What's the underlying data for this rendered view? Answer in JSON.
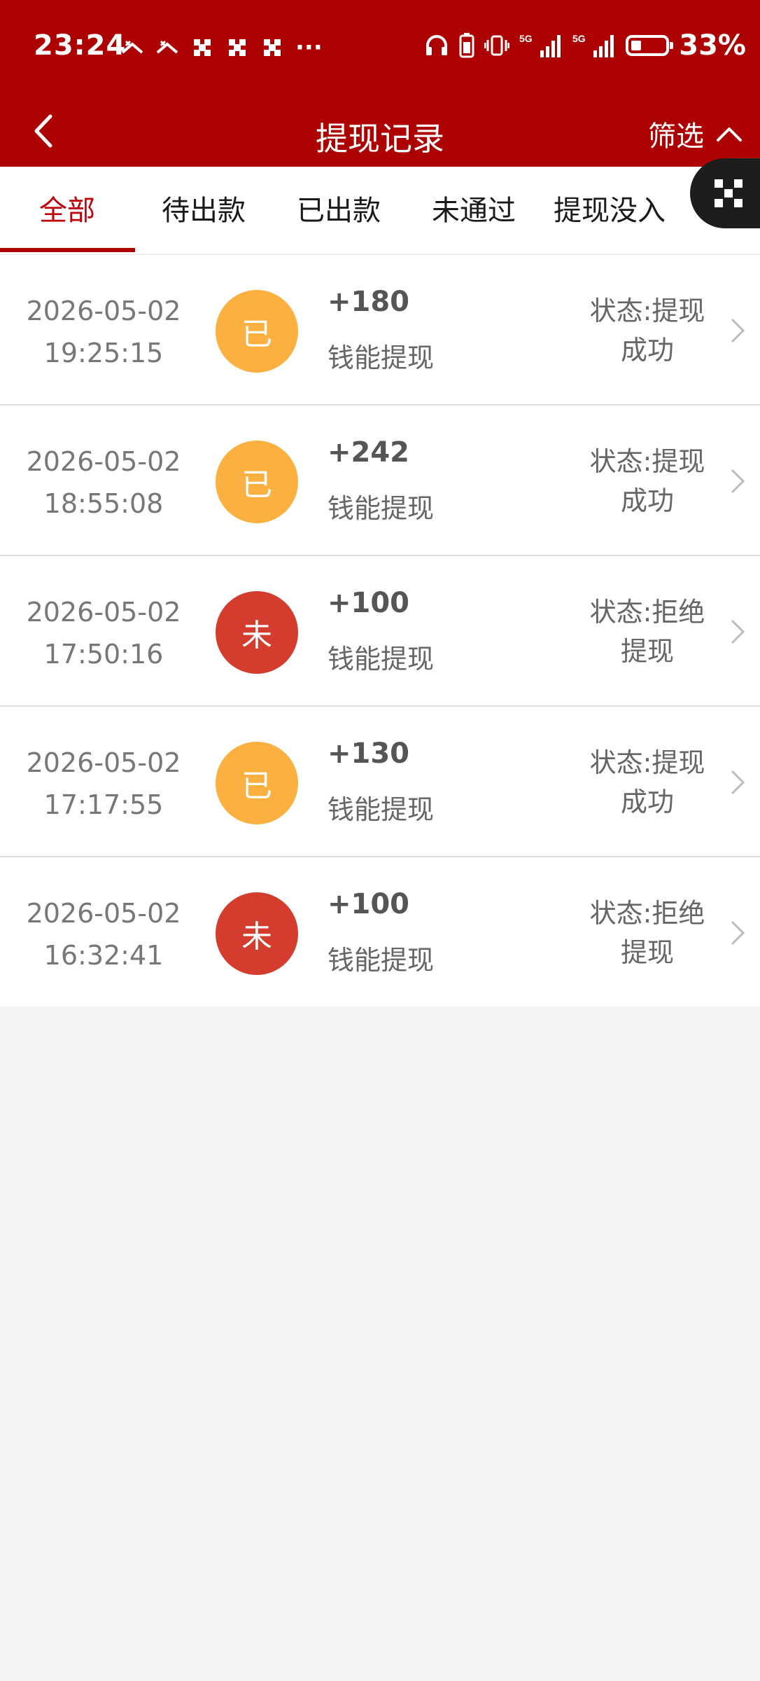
{
  "status_bar": {
    "time": "23:24",
    "battery_percent": "33%",
    "notification_icons": [
      "missed-call-icon",
      "missed-call-icon",
      "app-icon",
      "app-icon",
      "app-icon",
      "more-dots-icon"
    ],
    "system_icons": [
      "headphones-icon",
      "battery-saver-icon",
      "vibrate-icon",
      "signal-5g-icon",
      "signal-5g-icon",
      "battery-icon"
    ],
    "ellipsis": "···"
  },
  "header": {
    "title": "提现记录",
    "filter_label": "筛选",
    "brand_color": "#ad0000"
  },
  "tabs": [
    {
      "label": "全部",
      "active": true
    },
    {
      "label": "待出款",
      "active": false
    },
    {
      "label": "已出款",
      "active": false
    },
    {
      "label": "未通过",
      "active": false
    },
    {
      "label": "提现没入",
      "active": false
    }
  ],
  "records": [
    {
      "date": "2026-05-02",
      "time": "19:25:15",
      "badge": "已",
      "badge_color": "#fbb040",
      "amount": "+180",
      "type": "钱能提现",
      "status_line1": "状态:提现",
      "status_line2": "成功"
    },
    {
      "date": "2026-05-02",
      "time": "18:55:08",
      "badge": "已",
      "badge_color": "#fbb040",
      "amount": "+242",
      "type": "钱能提现",
      "status_line1": "状态:提现",
      "status_line2": "成功"
    },
    {
      "date": "2026-05-02",
      "time": "17:50:16",
      "badge": "未",
      "badge_color": "#d43c2e",
      "amount": "+100",
      "type": "钱能提现",
      "status_line1": "状态:拒绝",
      "status_line2": "提现"
    },
    {
      "date": "2026-05-02",
      "time": "17:17:55",
      "badge": "已",
      "badge_color": "#fbb040",
      "amount": "+130",
      "type": "钱能提现",
      "status_line1": "状态:提现",
      "status_line2": "成功"
    },
    {
      "date": "2026-05-02",
      "time": "16:32:41",
      "badge": "未",
      "badge_color": "#d43c2e",
      "amount": "+100",
      "type": "钱能提现",
      "status_line1": "状态:拒绝",
      "status_line2": "提现"
    }
  ]
}
